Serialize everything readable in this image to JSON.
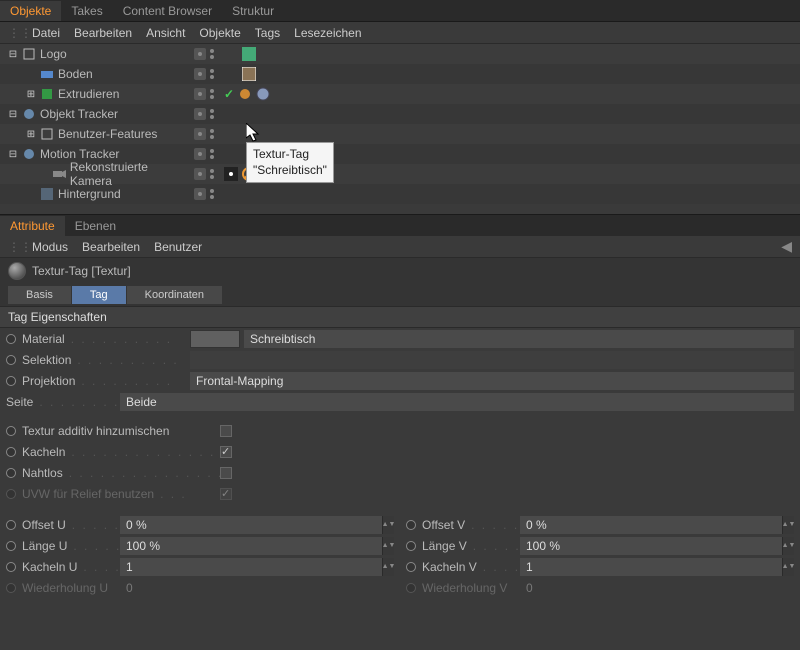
{
  "top_tabs": {
    "objects": "Objekte",
    "takes": "Takes",
    "content": "Content Browser",
    "struktur": "Struktur"
  },
  "menus": {
    "datei": "Datei",
    "bearbeiten": "Bearbeiten",
    "ansicht": "Ansicht",
    "objekte": "Objekte",
    "tags": "Tags",
    "lesezeichen": "Lesezeichen"
  },
  "tree": {
    "logo": "Logo",
    "boden": "Boden",
    "extrudieren": "Extrudieren",
    "otracker": "Objekt Tracker",
    "bfeatures": "Benutzer-Features",
    "mtracker": "Motion Tracker",
    "rkamera": "Rekonstruierte Kamera",
    "hintergrund": "Hintergrund"
  },
  "tooltip": {
    "line1": "Textur-Tag",
    "line2": "\"Schreibtisch\""
  },
  "attr_tabs": {
    "attribute": "Attribute",
    "ebenen": "Ebenen"
  },
  "attr_menus": {
    "modus": "Modus",
    "bearbeiten": "Bearbeiten",
    "benutzer": "Benutzer"
  },
  "attr_header": "Textur-Tag [Textur]",
  "sub_tabs": {
    "basis": "Basis",
    "tag": "Tag",
    "koordinaten": "Koordinaten"
  },
  "section": "Tag Eigenschaften",
  "props": {
    "material": "Material",
    "material_val": "Schreibtisch",
    "selektion": "Selektion",
    "projektion": "Projektion",
    "projektion_val": "Frontal-Mapping",
    "seite": "Seite",
    "seite_val": "Beide",
    "textur_additiv": "Textur additiv hinzumischen",
    "kacheln": "Kacheln",
    "nahtlos": "Nahtlos",
    "uvw_relief": "UVW für Relief benutzen"
  },
  "uv": {
    "offset_u": "Offset U",
    "offset_u_val": "0 %",
    "offset_v": "Offset V",
    "offset_v_val": "0 %",
    "laenge_u": "Länge U",
    "laenge_u_val": "100 %",
    "laenge_v": "Länge V",
    "laenge_v_val": "100 %",
    "kacheln_u": "Kacheln U",
    "kacheln_u_val": "1",
    "kacheln_v": "Kacheln V",
    "kacheln_v_val": "1",
    "wieder_u": "Wiederholung U",
    "wieder_u_val": "0",
    "wieder_v": "Wiederholung V",
    "wieder_v_val": "0"
  }
}
